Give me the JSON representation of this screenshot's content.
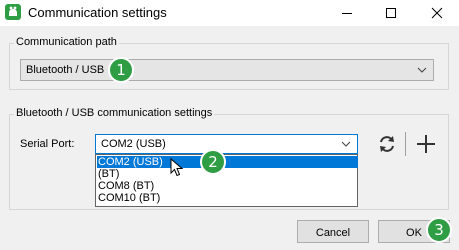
{
  "window": {
    "title": "Communication settings",
    "accent_color": "#2f9d44",
    "title_icon": "app-icon"
  },
  "communication_path": {
    "group_label": "Communication path",
    "selected_value": "Bluetooth / USB"
  },
  "bt_usb_settings": {
    "group_label": "Bluetooth / USB communication settings",
    "serial_port_label": "Serial Port:",
    "serial_port_value": "COM2 (USB)",
    "dropdown_options": [
      "COM2 (USB)",
      "(BT)",
      "COM8 (BT)",
      "COM10 (BT)"
    ],
    "highlighted_option_index": 0,
    "refresh_icon": "refresh-icon",
    "add_icon": "plus-icon"
  },
  "buttons": {
    "cancel": "Cancel",
    "ok": "OK"
  },
  "annotations": {
    "step1": "1",
    "step2": "2",
    "step3": "3"
  }
}
